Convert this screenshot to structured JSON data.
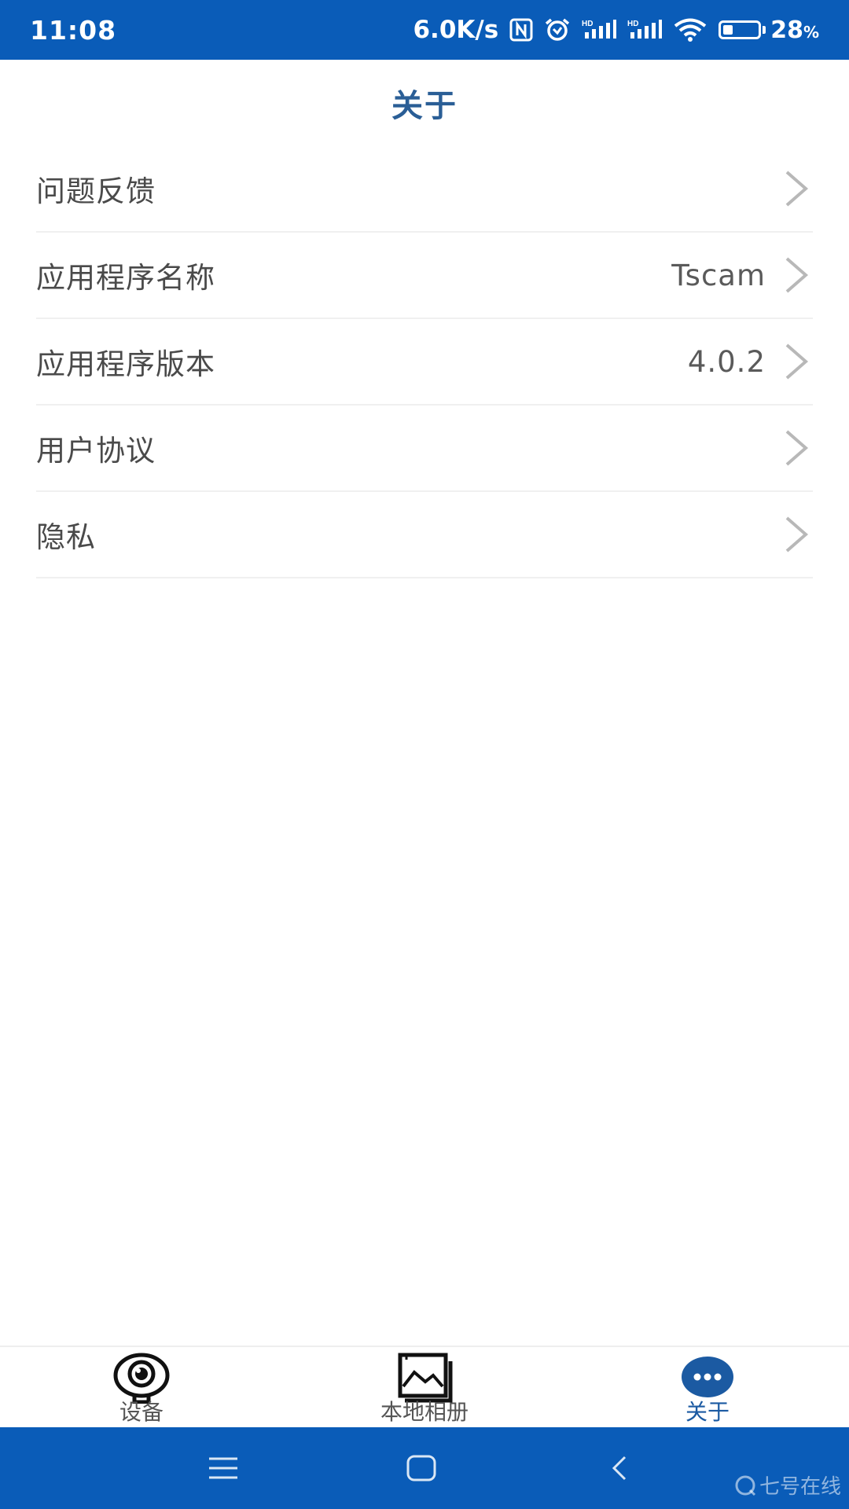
{
  "status_bar": {
    "time": "11:08",
    "net_speed": "6.0K/s",
    "battery_percent": "28",
    "battery_unit": "%",
    "battery_level": 0.28,
    "icons": [
      "nfc-icon",
      "alarm-icon",
      "hd-signal-icon",
      "hd-signal-icon",
      "wifi-icon",
      "battery-icon"
    ]
  },
  "header": {
    "title": "关于"
  },
  "settings": {
    "items": [
      {
        "label": "问题反馈",
        "value": ""
      },
      {
        "label": "应用程序名称",
        "value": "Tscam"
      },
      {
        "label": "应用程序版本",
        "value": "4.0.2"
      },
      {
        "label": "用户协议",
        "value": ""
      },
      {
        "label": "隐私",
        "value": ""
      }
    ]
  },
  "bottom_nav": {
    "tabs": [
      {
        "label": "设备",
        "icon": "camera-icon",
        "active": false
      },
      {
        "label": "本地相册",
        "icon": "album-icon",
        "active": false
      },
      {
        "label": "关于",
        "icon": "more-icon",
        "active": true
      }
    ]
  },
  "system_nav": {
    "icons": [
      "menu-icon",
      "home-icon",
      "back-icon"
    ]
  },
  "watermark": {
    "text": "七号在线"
  },
  "colors": {
    "bar_blue": "#0a5cb8",
    "title_blue": "#2a5e96",
    "active_blue": "#1b5aa2"
  }
}
